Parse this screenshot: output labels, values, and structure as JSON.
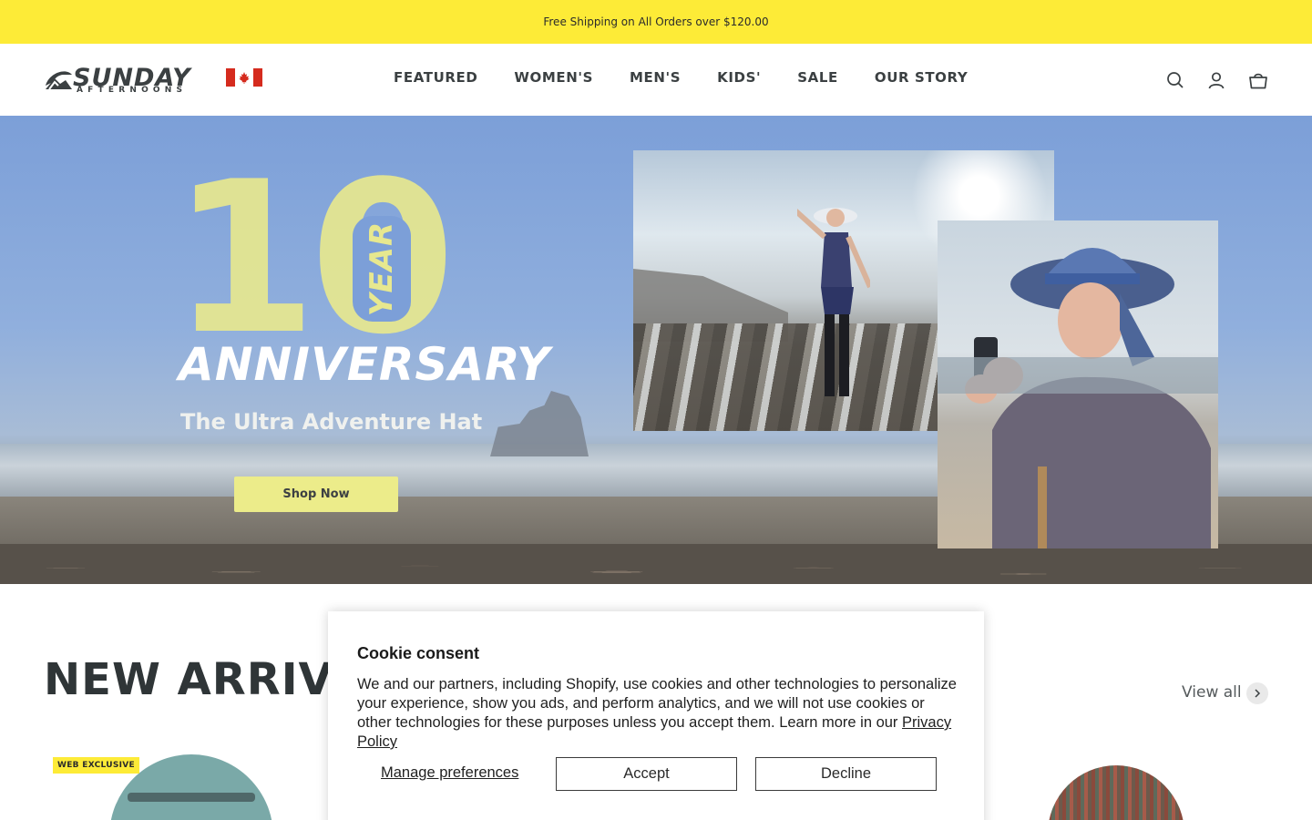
{
  "announcement": "Free Shipping on All Orders over $120.00",
  "brand": {
    "name": "SUNDAY",
    "sub": "AFTERNOONS"
  },
  "nav": [
    "FEATURED",
    "WOMEN'S",
    "MEN'S",
    "KIDS'",
    "SALE",
    "OUR STORY"
  ],
  "header_icons": [
    "search-icon",
    "account-icon",
    "cart-icon"
  ],
  "hero": {
    "number": "10",
    "year": "YEAR",
    "headline": "ANNIVERSARY",
    "subtitle": "The Ultra Adventure Hat",
    "cta": "Shop Now"
  },
  "section": {
    "title": "NEW ARRIVALS",
    "view_all": "View all",
    "badge": "WEB EXCLUSIVE"
  },
  "cookie": {
    "title": "Cookie consent",
    "body": "We and our partners, including Shopify, use cookies and other technologies to personalize your experience, show you ads, and perform analytics, and we will not use cookies or other technologies for these purposes unless you accept them. Learn more in our ",
    "link": "Privacy Policy",
    "manage": "Manage preferences",
    "accept": "Accept",
    "decline": "Decline"
  },
  "colors": {
    "announcement_bg": "#fdeb37",
    "accent_yellow": "#e7e88f",
    "text_dark": "#2f3537"
  }
}
